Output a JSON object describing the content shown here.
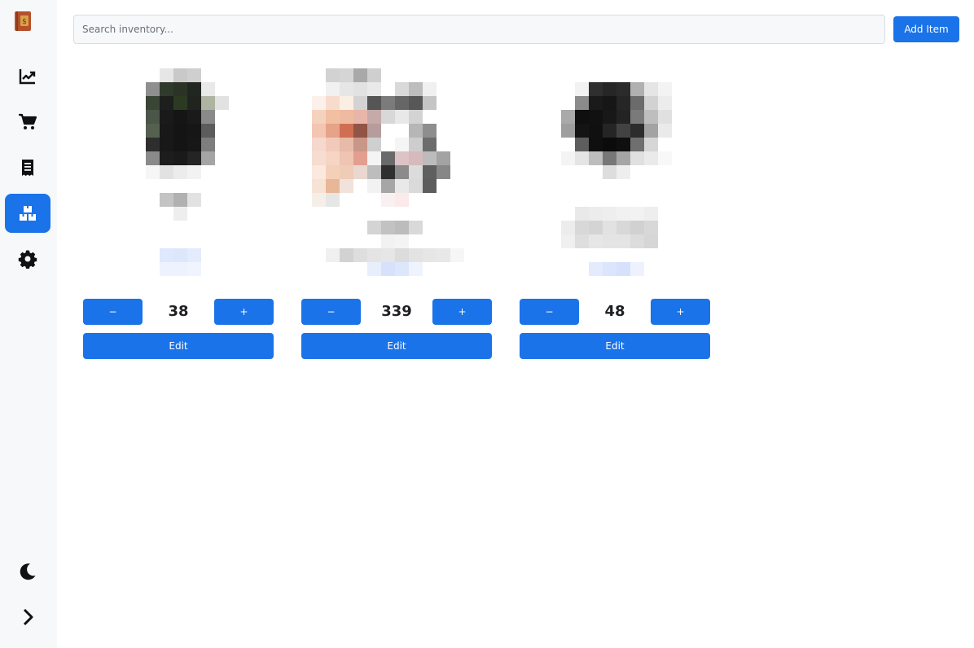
{
  "sidebar": {
    "logo_icon": "ledger-book-icon",
    "nav": [
      {
        "icon": "chart-line-icon",
        "active": false
      },
      {
        "icon": "shopping-cart-icon",
        "active": false
      },
      {
        "icon": "receipt-icon",
        "active": false
      },
      {
        "icon": "boxes-stacked-icon",
        "active": true
      },
      {
        "icon": "gear-icon",
        "active": false
      }
    ],
    "bottom": [
      {
        "icon": "moon-icon"
      },
      {
        "icon": "chevron-right-icon"
      }
    ]
  },
  "search": {
    "placeholder": "Search inventory...",
    "value": ""
  },
  "toolbar": {
    "add_label": "Add Item"
  },
  "items": [
    {
      "quantity": "38",
      "minus_label": "−",
      "plus_label": "+",
      "edit_label": "Edit"
    },
    {
      "quantity": "339",
      "minus_label": "−",
      "plus_label": "+",
      "edit_label": "Edit"
    },
    {
      "quantity": "48",
      "minus_label": "−",
      "plus_label": "+",
      "edit_label": "Edit"
    }
  ],
  "colors": {
    "accent": "#1a73e8",
    "sidebar_bg": "#f7f8fa"
  }
}
